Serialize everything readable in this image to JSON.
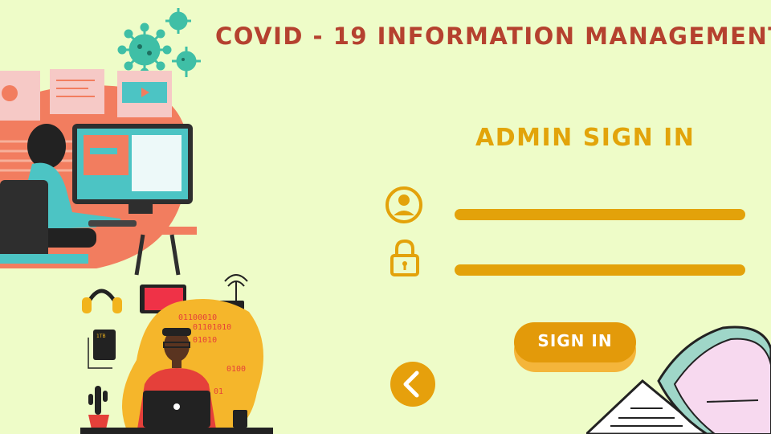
{
  "app": {
    "title": "COVID - 19 INFORMATION MANAGEMENT"
  },
  "form": {
    "heading": "ADMIN SIGN IN",
    "username_icon": "user-circle-icon",
    "password_icon": "padlock-icon",
    "sign_in_label": "SIGN IN",
    "back_icon": "chevron-left-icon"
  },
  "decor": {
    "binary_lines": [
      "01100010",
      "01101010",
      "01010",
      "0100",
      "01"
    ],
    "hdd_label": "1TB"
  },
  "colors": {
    "background": "#eefcc8",
    "title": "#b5412f",
    "accent": "#e3a20a",
    "virus": "#3fbfa6"
  }
}
